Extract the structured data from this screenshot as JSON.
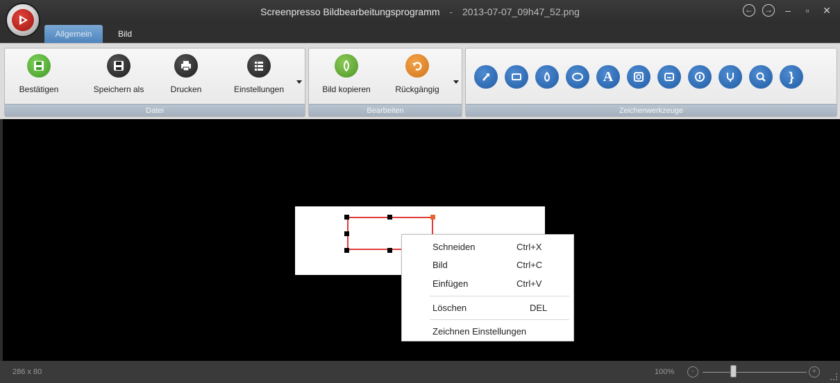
{
  "window": {
    "app_name": "Screenpresso",
    "title": "Bildbearbeitungsprogramm",
    "separator": "-",
    "filename": "2013-07-07_09h47_52.png"
  },
  "tabs": [
    {
      "label": "Allgemein",
      "active": true
    },
    {
      "label": "Bild",
      "active": false
    }
  ],
  "ribbon": {
    "datei": {
      "label": "Datei",
      "buttons": [
        {
          "label": "Bestätigen",
          "icon": "save-green-icon"
        },
        {
          "label": "Speichern als",
          "icon": "save-as-icon"
        },
        {
          "label": "Drucken",
          "icon": "printer-icon"
        },
        {
          "label": "Einstellungen",
          "icon": "settings-list-icon"
        }
      ]
    },
    "bearbeiten": {
      "label": "Bearbeiten",
      "buttons": [
        {
          "label": "Bild kopieren",
          "icon": "copy-image-icon"
        },
        {
          "label": "Rückgängig",
          "icon": "undo-icon"
        }
      ]
    },
    "zeichenwerkzeuge": {
      "label": "Zeichenwerkzeuge",
      "tools": [
        "arrow-icon",
        "rectangle-icon",
        "highlighter-icon",
        "ellipse-icon",
        "text-icon",
        "magnifier-box-icon",
        "callout-icon",
        "step-number-icon",
        "pen-icon",
        "zoom-icon",
        "bracket-icon"
      ]
    }
  },
  "context_menu": [
    {
      "label": "Schneiden",
      "shortcut": "Ctrl+X"
    },
    {
      "label": "Bild",
      "shortcut": "Ctrl+C"
    },
    {
      "label": "Einfügen",
      "shortcut": "Ctrl+V"
    },
    {
      "label": "Löschen",
      "shortcut": "DEL"
    },
    {
      "label": "Zeichnen Einstellungen",
      "shortcut": ""
    }
  ],
  "status": {
    "dimensions": "286 x 80",
    "zoom": "100%"
  },
  "colors": {
    "accent_blue": "#1f5ca4",
    "selection_red": "#e23b3b",
    "ribbon_group_label": "#a4b0bd"
  }
}
